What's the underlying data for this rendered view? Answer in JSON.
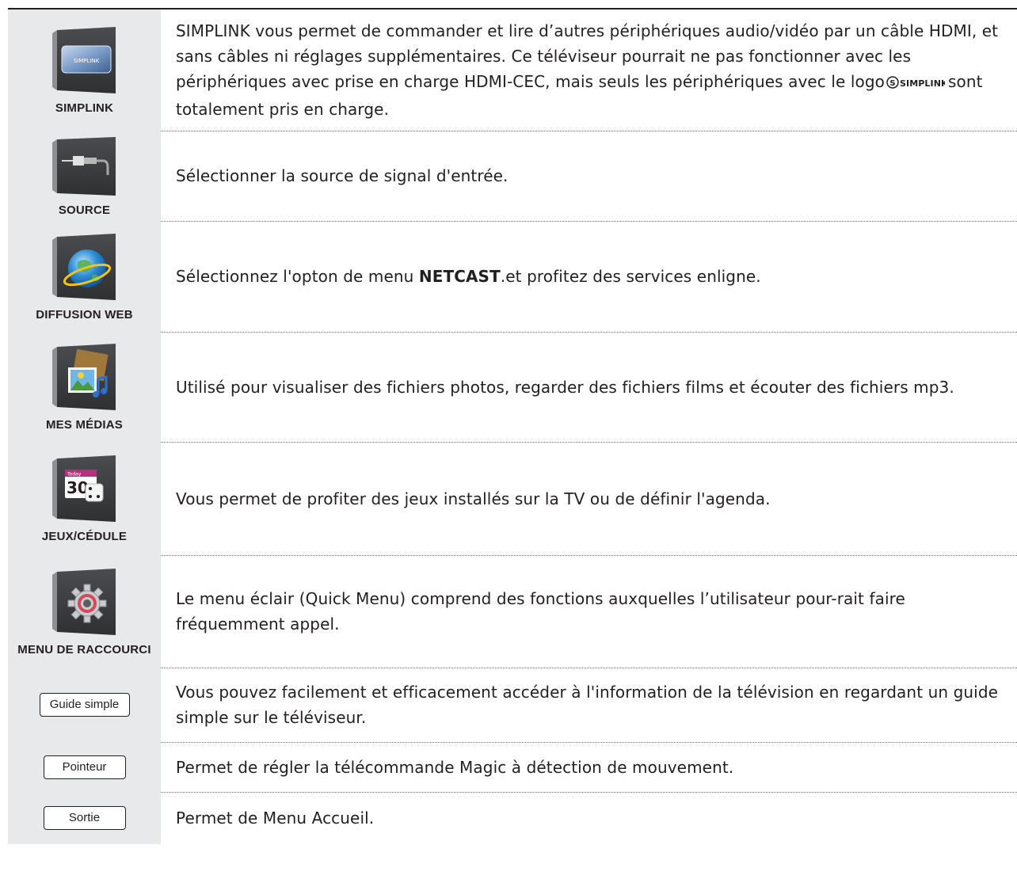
{
  "rows": [
    {
      "label": "SIMPLINK",
      "icon": "simplink-icon",
      "tile_text": "SIMPLINK",
      "text_a": "SIMPLINK vous permet de commander et lire d’autres périphériques audio/vidéo par un câble HDMI, et sans câbles ni réglages supplémentaires. Ce téléviseur pourrait ne pas fonctionner avec les périphériques avec prise en charge HDMI-CEC, mais seuls les périphériques avec le logo",
      "inline_logo_text": "SIMPLINK",
      "text_b": "sont totalement pris en charge."
    },
    {
      "label": "SOURCE",
      "icon": "source-plug-icon",
      "text": "Sélectionner la source de signal d'entrée."
    },
    {
      "label": "DIFFUSION WEB",
      "icon": "globe-icon",
      "text_a": "Sélectionnez l'opton de menu ",
      "text_bold": "NETCAST",
      "text_b": ".et profitez des services enligne."
    },
    {
      "label": "MES MÉDIAS",
      "icon": "media-icon",
      "text": "Utilisé pour visualiser des fichiers photos, regarder des fichiers films et écouter des fichiers mp3."
    },
    {
      "label": "JEUX/CÉDULE",
      "icon": "calendar-dice-icon",
      "calendar_tag": "Today",
      "calendar_day": "30",
      "text": "Vous permet de profiter des jeux installés sur la TV ou de définir l'agenda."
    },
    {
      "label": "MENU DE RACCOURCI",
      "icon": "gear-icon",
      "text": "Le menu éclair (Quick Menu) comprend des fonctions auxquelles l’utilisateur pour-rait faire fréquemment appel."
    },
    {
      "button": "Guide simple",
      "text": "Vous pouvez facilement et efficacement accéder à l'information de la télévision en regardant un guide simple sur le téléviseur."
    },
    {
      "button": "Pointeur",
      "text": "Permet de régler la télécommande Magic à détection de mouvement."
    },
    {
      "button": "Sortie",
      "text": "Permet de Menu Accueil."
    }
  ],
  "colors": {
    "icon_column_bg": "#e8e9ea",
    "tile_dark": "#3a3b3d",
    "text": "#231f20"
  }
}
